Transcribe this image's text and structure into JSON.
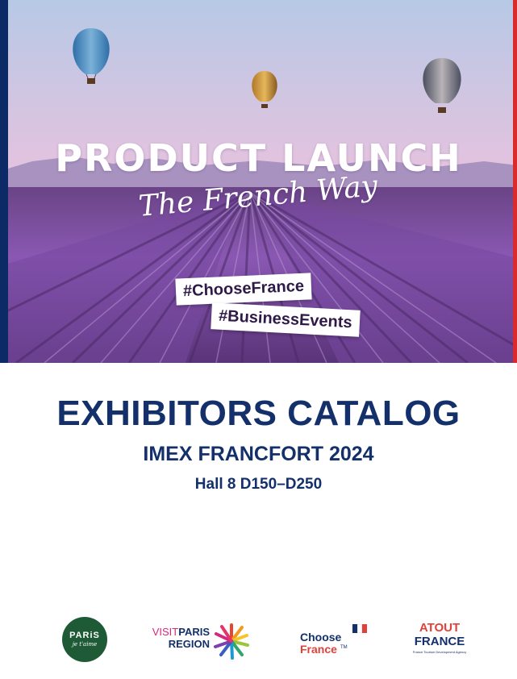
{
  "cover": {
    "headline": "PRODUCT LAUNCH",
    "script_line": "The French Way",
    "tags": [
      "#ChooseFrance",
      "#BusinessEvents"
    ]
  },
  "catalog": {
    "title": "EXHIBITORS CATALOG",
    "event": "IMEX FRANCFORT 2024",
    "location": "Hall 8 D150–D250"
  },
  "partners": {
    "paris": {
      "line1": "PARiS",
      "line2": "je t'aime"
    },
    "visit": {
      "visit": "VISIT",
      "paris": "PARIS",
      "region": "REGION"
    },
    "choose": {
      "line1": "Choose",
      "line2": "France",
      "mark": "TM"
    },
    "atout": {
      "line1": "ATOUT",
      "line2": "FRANCE",
      "tagline": "France Tourism Development Agency"
    }
  },
  "colors": {
    "navy": "#13306b",
    "accent_red": "#d92b2b",
    "lavender": "#7b4aa6",
    "sky": "#e7c6dd"
  },
  "icons": [
    "hot-air-balloon",
    "sunburst-logo",
    "french-flag"
  ]
}
